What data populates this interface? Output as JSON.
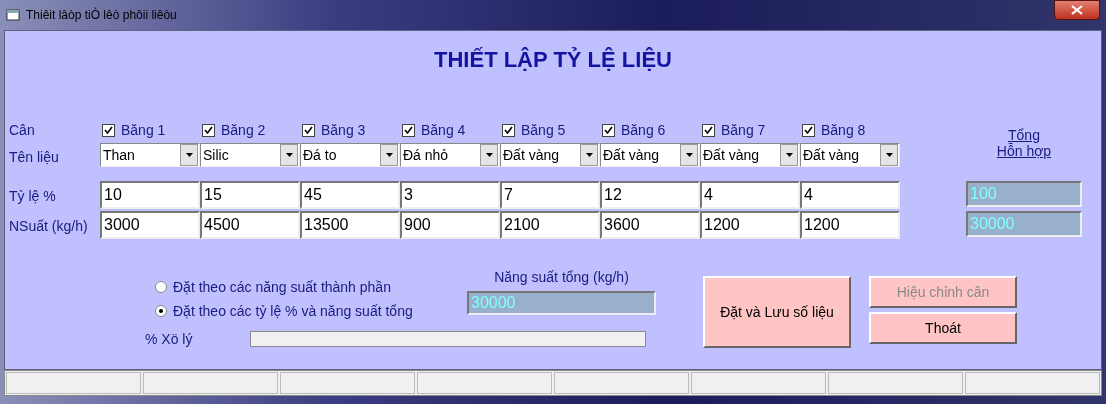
{
  "window": {
    "title": "Thiêit lâòp tiÒ lêò phôii liêòu"
  },
  "heading": "THIẾT LẬP TỶ LỆ LIỆU",
  "row_labels": {
    "scale": "Cân",
    "material": "Tên liệu",
    "ratio": "Tỷ lệ %",
    "output": "NSuất (kg/h)"
  },
  "belts": [
    {
      "label": "Băng 1",
      "checked": true,
      "material": "Than",
      "ratio": "10",
      "output": "3000"
    },
    {
      "label": "Băng 2",
      "checked": true,
      "material": "Silic",
      "ratio": "15",
      "output": "4500"
    },
    {
      "label": "Băng 3",
      "checked": true,
      "material": "Đá to",
      "ratio": "45",
      "output": "13500"
    },
    {
      "label": "Băng 4",
      "checked": true,
      "material": "Đá nhỏ",
      "ratio": "3",
      "output": "900"
    },
    {
      "label": "Băng 5",
      "checked": true,
      "material": "Đất vàng",
      "ratio": "7",
      "output": "2100"
    },
    {
      "label": "Băng 6",
      "checked": true,
      "material": "Đất vàng",
      "ratio": "12",
      "output": "3600"
    },
    {
      "label": "Băng 7",
      "checked": true,
      "material": "Đất vàng",
      "ratio": "4",
      "output": "1200"
    },
    {
      "label": "Băng 8",
      "checked": true,
      "material": "Đất vàng",
      "ratio": "4",
      "output": "1200"
    }
  ],
  "totals": {
    "heading_1": "Tổng",
    "heading_2": "Hỗn hợp",
    "ratio": "100",
    "output": "30000"
  },
  "modes": [
    {
      "label": "Đặt theo các năng suất thành phần",
      "selected": false
    },
    {
      "label": "Đặt theo các tỷ lệ % và năng suất tổng",
      "selected": true
    }
  ],
  "total_output": {
    "label": "Năng suất tổng (kg/h)",
    "value": "30000"
  },
  "progress": {
    "label": "% Xö lý",
    "level": 0
  },
  "buttons": [
    {
      "label": "Đặt và Lưu số liệu",
      "disabled": false
    },
    {
      "label": "Hiệu chỉnh cân",
      "disabled": true
    },
    {
      "label": "Thoát",
      "disabled": false
    }
  ]
}
